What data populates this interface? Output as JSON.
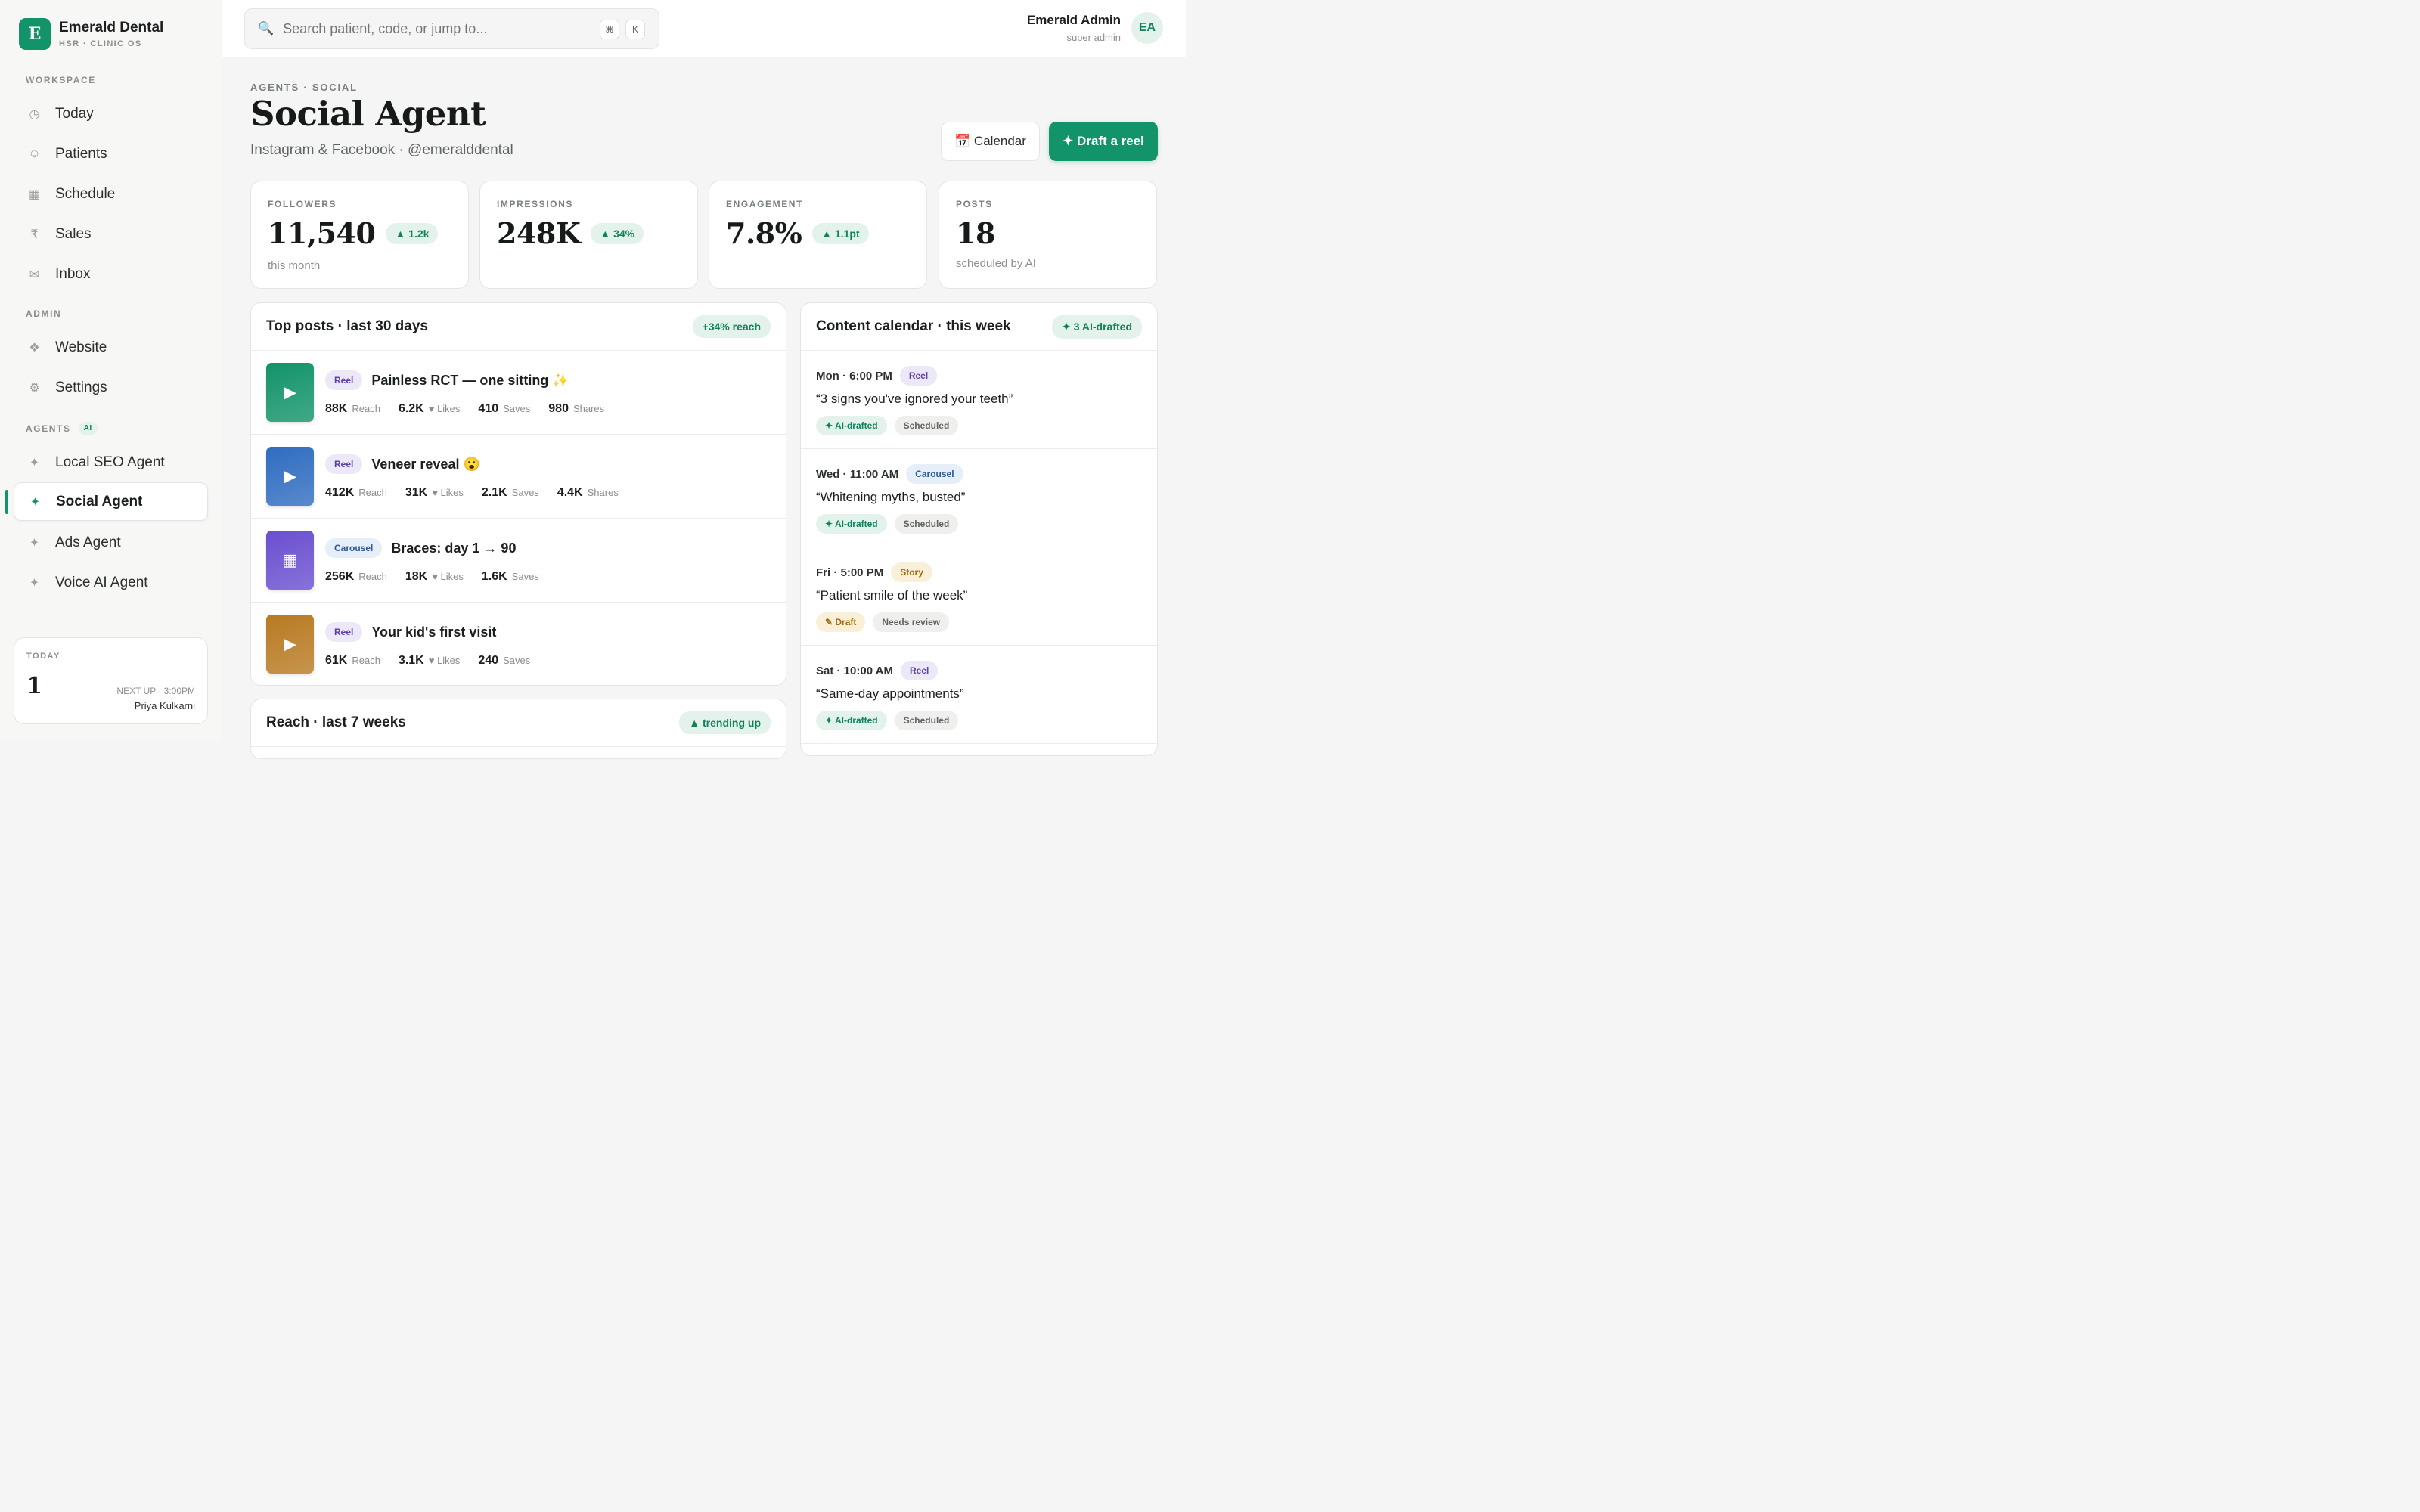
{
  "brand": {
    "logo_letter": "E",
    "name": "Emerald Dental",
    "sub": "HSR · CLINIC OS"
  },
  "sidebar": {
    "sections": [
      {
        "label": "WORKSPACE",
        "items": [
          {
            "label": "Today",
            "icon": "clock-icon",
            "glyph": "◷"
          },
          {
            "label": "Patients",
            "icon": "smiley-icon",
            "glyph": "☺"
          },
          {
            "label": "Schedule",
            "icon": "calendar-grid-icon",
            "glyph": "▦"
          },
          {
            "label": "Sales",
            "icon": "rupee-icon",
            "glyph": "₹"
          },
          {
            "label": "Inbox",
            "icon": "envelope-icon",
            "glyph": "✉"
          }
        ]
      },
      {
        "label": "ADMIN",
        "items": [
          {
            "label": "Website",
            "icon": "diamond-cluster-icon",
            "glyph": "❖"
          },
          {
            "label": "Settings",
            "icon": "gear-icon",
            "glyph": "⚙"
          }
        ]
      },
      {
        "label": "AGENTS",
        "badge": "AI",
        "items": [
          {
            "label": "Local SEO Agent",
            "icon": "sparkle-icon",
            "glyph": "✦"
          },
          {
            "label": "Social Agent",
            "icon": "sparkle-icon",
            "glyph": "✦",
            "active": true
          },
          {
            "label": "Ads Agent",
            "icon": "sparkle-icon",
            "glyph": "✦"
          },
          {
            "label": "Voice AI Agent",
            "icon": "sparkle-icon",
            "glyph": "✦"
          }
        ]
      }
    ],
    "today_card": {
      "label": "TODAY",
      "count": "1",
      "next_up": "NEXT UP · 3:00PM",
      "next_name": "Priya Kulkarni"
    }
  },
  "topbar": {
    "search_placeholder": "Search patient, code, or jump to...",
    "shortcut_keys": [
      "⌘",
      "K"
    ],
    "user": {
      "name": "Emerald Admin",
      "role": "super admin",
      "initials": "EA"
    }
  },
  "page": {
    "eyebrow": "AGENTS · SOCIAL",
    "title": "Social Agent",
    "subtitle": "Instagram & Facebook · @emeralddental",
    "calendar_button": "📅 Calendar",
    "draft_button": "✦ Draft a reel"
  },
  "stats": [
    {
      "label": "FOLLOWERS",
      "value": "11,540",
      "delta": "▲ 1.2k",
      "note": "this month"
    },
    {
      "label": "IMPRESSIONS",
      "value": "248K",
      "delta": "▲ 34%",
      "note": ""
    },
    {
      "label": "ENGAGEMENT",
      "value": "7.8%",
      "delta": "▲ 1.1pt",
      "note": ""
    },
    {
      "label": "POSTS",
      "value": "18",
      "delta": "",
      "note": "scheduled by AI"
    }
  ],
  "top_posts": {
    "title": "Top posts · last 30 days",
    "pill": "+34% reach",
    "posts": [
      {
        "type": "Reel",
        "title": "Painless RCT — one sitting ✨",
        "thumb_glyph": "▶",
        "thumb_icon": "play-icon",
        "thumb_color": "#12936a",
        "metrics": [
          {
            "v": "88K",
            "l": "Reach"
          },
          {
            "v": "6.2K",
            "l": "♥ Likes"
          },
          {
            "v": "410",
            "l": "Saves"
          },
          {
            "v": "980",
            "l": "Shares"
          }
        ]
      },
      {
        "type": "Reel",
        "title": "Veneer reveal 😮",
        "thumb_glyph": "▶",
        "thumb_icon": "play-icon",
        "thumb_color": "#2f6cc0",
        "metrics": [
          {
            "v": "412K",
            "l": "Reach"
          },
          {
            "v": "31K",
            "l": "♥ Likes"
          },
          {
            "v": "2.1K",
            "l": "Saves"
          },
          {
            "v": "4.4K",
            "l": "Shares"
          }
        ]
      },
      {
        "type": "Carousel",
        "title": "Braces: day 1 → 90",
        "thumb_glyph": "▦",
        "thumb_icon": "grid-icon",
        "thumb_color": "#6a4fcf",
        "metrics": [
          {
            "v": "256K",
            "l": "Reach"
          },
          {
            "v": "18K",
            "l": "♥ Likes"
          },
          {
            "v": "1.6K",
            "l": "Saves"
          }
        ]
      },
      {
        "type": "Reel",
        "title": "Your kid's first visit",
        "thumb_glyph": "▶",
        "thumb_icon": "play-icon",
        "thumb_color": "#b87a22",
        "metrics": [
          {
            "v": "61K",
            "l": "Reach"
          },
          {
            "v": "3.1K",
            "l": "♥ Likes"
          },
          {
            "v": "240",
            "l": "Saves"
          }
        ]
      }
    ]
  },
  "reach": {
    "title": "Reach · last 7 weeks",
    "pill": "▲ trending up"
  },
  "calendar": {
    "title": "Content calendar · this week",
    "pill": "✦ 3 AI-drafted",
    "items": [
      {
        "when": "Mon · 6:00 PM",
        "type": "Reel",
        "title": "“3 signs you've ignored your teeth”",
        "tags": [
          "✦ AI-drafted",
          "Scheduled"
        ]
      },
      {
        "when": "Wed · 11:00 AM",
        "type": "Carousel",
        "title": "“Whitening myths, busted”",
        "tags": [
          "✦ AI-drafted",
          "Scheduled"
        ]
      },
      {
        "when": "Fri · 5:00 PM",
        "type": "Story",
        "title": "“Patient smile of the week”",
        "tags": [
          "✎ Draft",
          "Needs review"
        ]
      },
      {
        "when": "Sat · 10:00 AM",
        "type": "Reel",
        "title": "“Same-day appointments”",
        "tags": [
          "✦ AI-drafted",
          "Scheduled"
        ]
      }
    ]
  },
  "colors": {
    "accent": "#12936a",
    "accent_soft": "#e3f3eb"
  }
}
